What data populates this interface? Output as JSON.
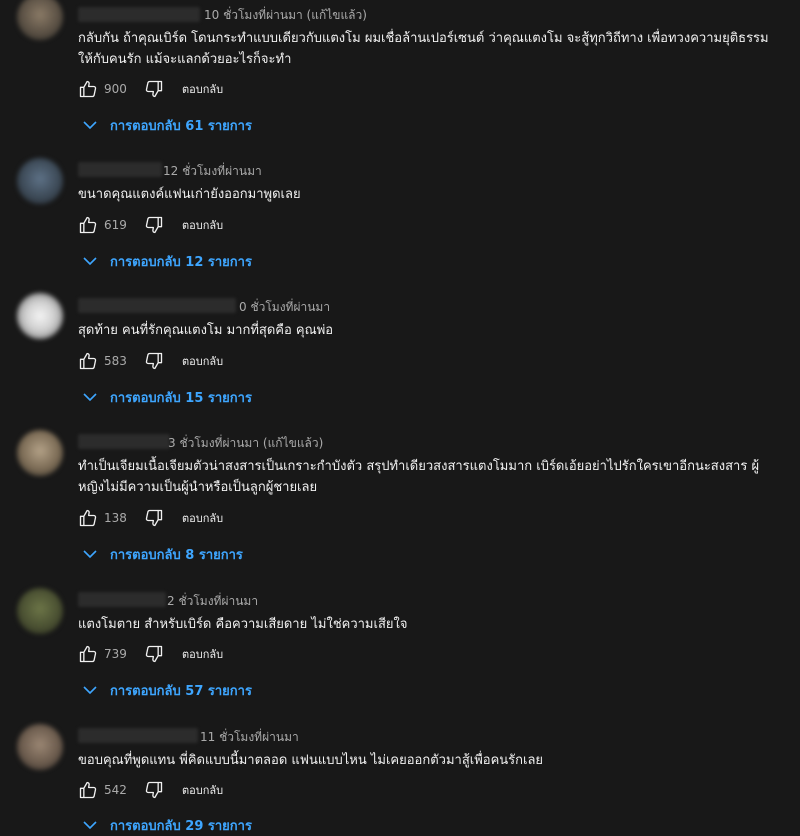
{
  "colors": {
    "background": "#181818",
    "text": "#f1f1f1",
    "secondary_text": "#aaaaaa",
    "link_blue": "#3ea6ff"
  },
  "icons": {
    "like": "thumb-up-icon",
    "dislike": "thumb-down-icon",
    "replies": "chevron-down-icon"
  },
  "comments": [
    {
      "time": "10 ชั่วโมงที่ผ่านมา (แก้ไขแล้ว)",
      "text": "กลับกัน ถ้าคุณเบิร์ด โดนกระทำแบบเดียวกับแตงโม ผมเชื่อล้านเปอร์เซนต์ ว่าคุณแตงโม จะสู้ทุกวิถีทาง เพื่อทวงความยุติธรรมให้กับคนรัก แม้จะแลกด้วยอะไรก็จะทำ",
      "likes": "900",
      "reply_label": "ตอบกลับ",
      "replies_label": "การตอบกลับ 61 รายการ"
    },
    {
      "time": "12 ชั่วโมงที่ผ่านมา",
      "text": "ขนาดคุณแตงค์แฟนเก่ายังออกมาพูดเลย",
      "likes": "619",
      "reply_label": "ตอบกลับ",
      "replies_label": "การตอบกลับ 12 รายการ"
    },
    {
      "time": "0 ชั่วโมงที่ผ่านมา",
      "text": "สุดท้าย คนที่รักคุณแตงโม มากที่สุดคือ คุณพ่อ",
      "likes": "583",
      "reply_label": "ตอบกลับ",
      "replies_label": "การตอบกลับ 15 รายการ"
    },
    {
      "time": "3 ชั่วโมงที่ผ่านมา (แก้ไขแล้ว)",
      "text": "ทำเป็นเจียมเนื้อเจียมตัวน่าสงสารเป็นเกราะกำบังตัว สรุปทำเดียวสงสารแตงโมมาก เบิร์ดเอ้ยอย่าไปรักใครเขาอีกนะสงสาร ผู้หญิงไม่มีความเป็นผู้นำหรือเป็นลูกผู้ชายเลย",
      "likes": "138",
      "reply_label": "ตอบกลับ",
      "replies_label": "การตอบกลับ 8 รายการ"
    },
    {
      "time": "2 ชั่วโมงที่ผ่านมา",
      "text": "แตงโมตาย สำหรับเบิร์ด คือความเสียดาย  ไม่ใช่ความเสียใจ",
      "likes": "739",
      "reply_label": "ตอบกลับ",
      "replies_label": "การตอบกลับ 57 รายการ"
    },
    {
      "time": "11 ชั่วโมงที่ผ่านมา",
      "text": "ขอบคุณที่พูดแทน พี่คิดแบบนี้มาตลอด แฟนแบบไหน ไม่เคยออกตัวมาสู้เพื่อคนรักเลย",
      "likes": "542",
      "reply_label": "ตอบกลับ",
      "replies_label": "การตอบกลับ 29 รายการ"
    }
  ]
}
